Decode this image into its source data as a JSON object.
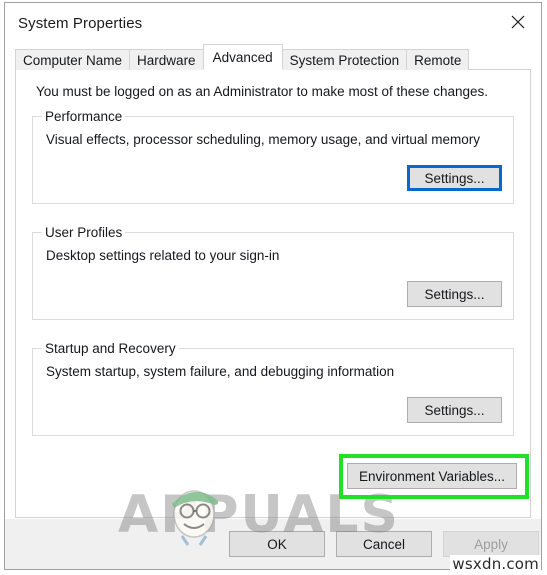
{
  "window": {
    "title": "System Properties",
    "close_icon": "close-icon"
  },
  "tabs": [
    {
      "label": "Computer Name",
      "active": false
    },
    {
      "label": "Hardware",
      "active": false
    },
    {
      "label": "Advanced",
      "active": true
    },
    {
      "label": "System Protection",
      "active": false
    },
    {
      "label": "Remote",
      "active": false
    }
  ],
  "panel": {
    "intro": "You must be logged on as an Administrator to make most of these changes.",
    "groups": [
      {
        "legend": "Performance",
        "description": "Visual effects, processor scheduling, memory usage, and virtual memory",
        "button": "Settings...",
        "focused": true
      },
      {
        "legend": "User Profiles",
        "description": "Desktop settings related to your sign-in",
        "button": "Settings...",
        "focused": false
      },
      {
        "legend": "Startup and Recovery",
        "description": "System startup, system failure, and debugging information",
        "button": "Settings...",
        "focused": false
      }
    ],
    "environment_variables_button": "Environment Variables..."
  },
  "footer": {
    "ok": "OK",
    "cancel": "Cancel",
    "apply": "Apply",
    "apply_disabled": true
  },
  "annotations": {
    "highlight_color": "#22e024",
    "highlight_target": "Environment Variables..."
  },
  "watermarks": {
    "brand": "APPUALS",
    "site": "wsxdn.com"
  },
  "colors": {
    "focus_blue": "#0a69c8",
    "window_border": "#a0a0a0",
    "button_face": "#e1e1e1",
    "footer_bg": "#f0f0f0"
  }
}
